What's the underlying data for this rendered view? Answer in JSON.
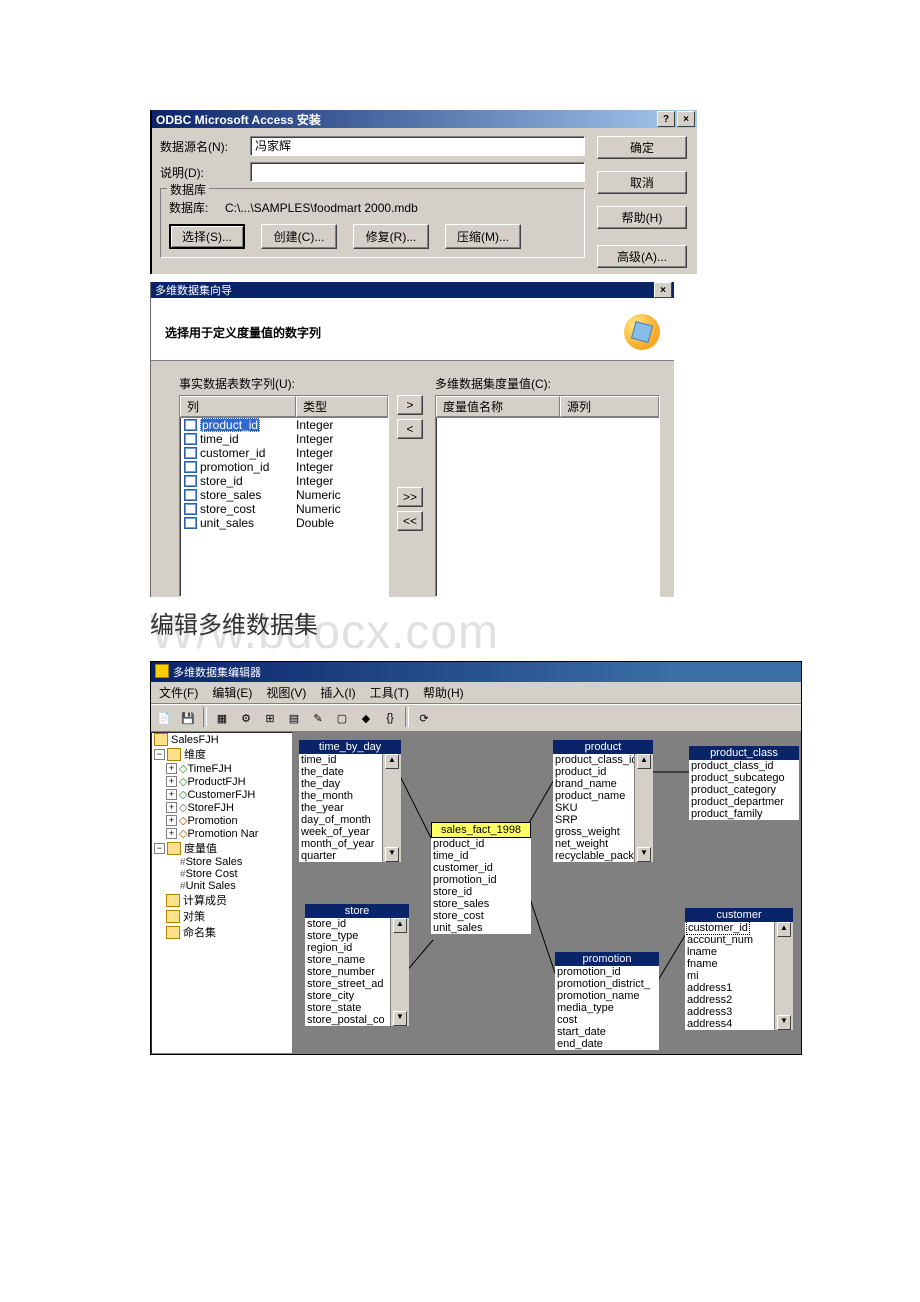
{
  "dialog1": {
    "title": "ODBC Microsoft Access 安装",
    "datasource_label": "数据源名(N):",
    "datasource_value": "冯家辉",
    "desc_label": "说明(D):",
    "desc_value": "",
    "database_group": "数据库",
    "database_label": "数据库:",
    "database_path": "C:\\...\\SAMPLES\\foodmart 2000.mdb",
    "btn_select": "选择(S)...",
    "btn_create": "创建(C)...",
    "btn_repair": "修复(R)...",
    "btn_compact": "压缩(M)...",
    "btn_ok": "确定",
    "btn_cancel": "取消",
    "btn_help": "帮助(H)",
    "btn_advanced": "高级(A)..."
  },
  "wizard": {
    "title": "多维数据集向导",
    "instruction": "选择用于定义度量值的数字列",
    "left_label": "事实数据表数字列(U):",
    "right_label": "多维数据集度量值(C):",
    "col_header": "列",
    "type_header": "类型",
    "measure_name_header": "度量值名称",
    "source_header": "源列",
    "btn_add": ">",
    "btn_remove": "<",
    "btn_add_all": ">>",
    "btn_remove_all": "<<",
    "columns": [
      {
        "name": "product_id",
        "type": "Integer",
        "selected": true
      },
      {
        "name": "time_id",
        "type": "Integer"
      },
      {
        "name": "customer_id",
        "type": "Integer"
      },
      {
        "name": "promotion_id",
        "type": "Integer"
      },
      {
        "name": "store_id",
        "type": "Integer"
      },
      {
        "name": "store_sales",
        "type": "Numeric"
      },
      {
        "name": "store_cost",
        "type": "Numeric"
      },
      {
        "name": "unit_sales",
        "type": "Double"
      }
    ]
  },
  "section_heading": "编辑多维数据集",
  "watermark": "/w.bdocx.com",
  "editor": {
    "title": "多维数据集编辑器",
    "menu": {
      "file": "文件(F)",
      "edit": "编辑(E)",
      "view": "视图(V)",
      "insert": "插入(I)",
      "tools": "工具(T)",
      "help": "帮助(H)"
    },
    "tree": {
      "root": "SalesFJH",
      "dims_label": "维度",
      "dims": [
        "TimeFJH",
        "ProductFJH",
        "CustomerFJH",
        "StoreFJH",
        "Promotion",
        "Promotion Nar"
      ],
      "measures_label": "度量值",
      "measures": [
        "Store Sales",
        "Store Cost",
        "Unit Sales"
      ],
      "calc": "计算成员",
      "actions": "对策",
      "named": "命名集"
    },
    "tables": {
      "time_by_day": {
        "title": "time_by_day",
        "cols": [
          "time_id",
          "the_date",
          "the_day",
          "the_month",
          "the_year",
          "day_of_month",
          "week_of_year",
          "month_of_year",
          "quarter"
        ]
      },
      "sales_fact": {
        "title": "sales_fact_1998",
        "cols": [
          "product_id",
          "time_id",
          "customer_id",
          "promotion_id",
          "store_id",
          "store_sales",
          "store_cost",
          "unit_sales"
        ]
      },
      "product": {
        "title": "product",
        "cols": [
          "product_class_id",
          "product_id",
          "brand_name",
          "product_name",
          "SKU",
          "SRP",
          "gross_weight",
          "net_weight",
          "recyclable_pack"
        ]
      },
      "product_class": {
        "title": "product_class",
        "cols": [
          "product_class_id",
          "product_subcatego",
          "product_category",
          "product_departmer",
          "product_family"
        ]
      },
      "store": {
        "title": "store",
        "cols": [
          "store_id",
          "store_type",
          "region_id",
          "store_name",
          "store_number",
          "store_street_ad",
          "store_city",
          "store_state",
          "store_postal_co"
        ]
      },
      "promotion": {
        "title": "promotion",
        "cols": [
          "promotion_id",
          "promotion_district_",
          "promotion_name",
          "media_type",
          "cost",
          "start_date",
          "end_date"
        ]
      },
      "customer": {
        "title": "customer",
        "cols": [
          "customer_id",
          "account_num",
          "lname",
          "fname",
          "mi",
          "address1",
          "address2",
          "address3",
          "address4"
        ]
      }
    }
  }
}
